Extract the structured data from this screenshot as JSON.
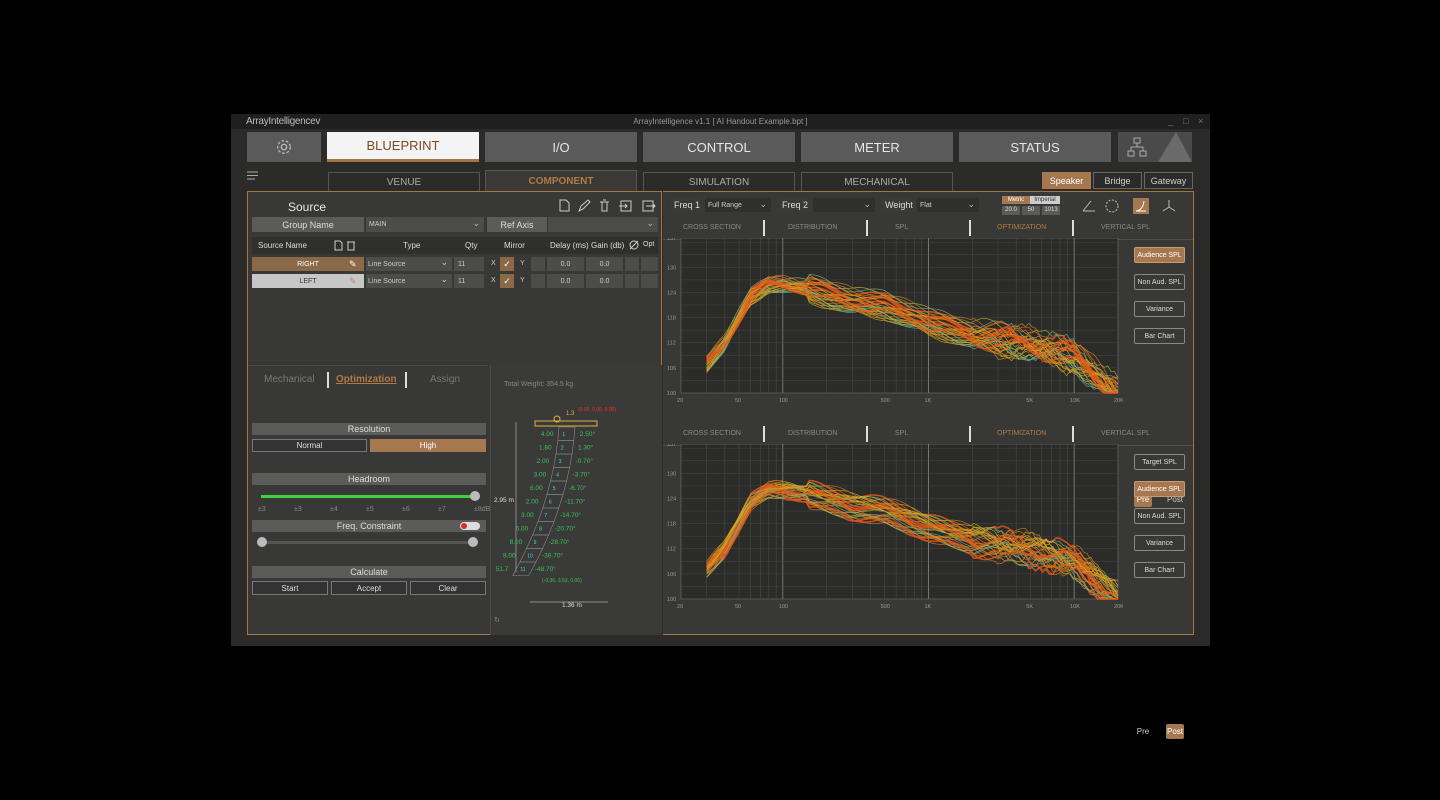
{
  "window": {
    "brand": "ArrayIntelligencev",
    "title": "ArrayIntelligence v1.1 [ AI Handout Example.bpt ]",
    "controls": [
      "_",
      "□",
      "×"
    ]
  },
  "nav": {
    "settings_icon": "gear-icon",
    "tabs": [
      "BLUEPRINT",
      "I/O",
      "CONTROL",
      "METER",
      "STATUS"
    ],
    "active_tab": "BLUEPRINT",
    "network_icon": "network-icon"
  },
  "subtabs": {
    "items": [
      "VENUE",
      "COMPONENT",
      "SIMULATION",
      "MECHANICAL"
    ],
    "active": "COMPONENT"
  },
  "mode_buttons": {
    "items": [
      "Speaker",
      "Bridge",
      "Gateway"
    ],
    "active": "Speaker"
  },
  "source": {
    "title": "Source",
    "group_name_label": "Group Name",
    "group_name_value": "MAIN",
    "ref_axis_label": "Ref Axis",
    "ref_axis_value": "",
    "columns": [
      "Source Name",
      "Type",
      "Qty",
      "Mirror",
      "Delay (ms)",
      "Gain (db)",
      "Opt"
    ],
    "rows": [
      {
        "name": "RIGHT",
        "type": "Line Source",
        "qty": "11",
        "x": "X",
        "y": "Y",
        "delay": "0.0",
        "gain": "0.0"
      },
      {
        "name": "LEFT",
        "type": "Line Source",
        "qty": "11",
        "x": "X",
        "y": "Y",
        "delay": "0.0",
        "gain": "0.0"
      }
    ]
  },
  "lower_tabs": {
    "items": [
      "Mechanical",
      "Optimization",
      "Assign"
    ],
    "active": "Optimization"
  },
  "optimization": {
    "resolution_label": "Resolution",
    "resolution_options": [
      "Normal",
      "High"
    ],
    "resolution_active": "High",
    "headroom_label": "Headroom",
    "headroom_ticks": [
      "±3",
      "±3",
      "±4",
      "±5",
      "±6",
      "±7",
      "±8dB"
    ],
    "headroom_value_pct": 100,
    "freq_constraint_label": "Freq. Constraint",
    "freq_constraint_on": true,
    "calculate_label": "Calculate",
    "calc_buttons": [
      "Start",
      "Accept",
      "Clear"
    ]
  },
  "array": {
    "total_weight": "Total Weight: 354.5 kg",
    "height_label": "2.95 m",
    "width_label": "1.36 m",
    "top_coords": "(0.00, 0.00, 0.00)",
    "bottom_coords": "(-0.36, 3.53, 0.06)",
    "top_gap": "1.3",
    "boxes": [
      {
        "n": "1",
        "left": "4.00",
        "right": "2.50°"
      },
      {
        "n": "2",
        "left": "1.80",
        "right": "1.30°"
      },
      {
        "n": "3",
        "left": "2.00",
        "right": "-0.70°"
      },
      {
        "n": "4",
        "left": "3.00",
        "right": "-3.70°"
      },
      {
        "n": "5",
        "left": "6.00",
        "right": "-6.70°"
      },
      {
        "n": "6",
        "left": "2.00",
        "right": "-11.70°"
      },
      {
        "n": "7",
        "left": "3.00",
        "right": "-14.70°"
      },
      {
        "n": "8",
        "left": "6.00",
        "right": "-20.70°"
      },
      {
        "n": "9",
        "left": "8.00",
        "right": "-28.70°"
      },
      {
        "n": "10",
        "left": "8.00",
        "right": "-36.70°"
      },
      {
        "n": "11",
        "left": "51.7",
        "right": "-48.70°"
      }
    ]
  },
  "analysis": {
    "freq1_label": "Freq 1",
    "freq1_value": "Full Range",
    "freq2_label": "Freq 2",
    "freq2_value": "",
    "weight_label": "Weight",
    "weight_value": "Flat",
    "unit_metric": "Metric",
    "unit_imperial": "Imperial",
    "env_values": [
      "20.0",
      "50",
      "1013"
    ],
    "plot_tabs": [
      "CROSS SECTION",
      "DISTRIBUTION",
      "SPL",
      "OPTIMIZATION",
      "VERTICAL SPL"
    ],
    "active_plot_tab": "OPTIMIZATION",
    "top_buttons": [
      "Audience SPL",
      "Non Aud. SPL",
      "Variance",
      "Bar Chart"
    ],
    "top_active": "Audience SPL",
    "top_pre_post": [
      "Pre",
      "Post"
    ],
    "top_prepost_active": "Pre",
    "bottom_buttons": [
      "Target SPL",
      "Audience SPL",
      "Non Aud. SPL",
      "Variance",
      "Bar Chart"
    ],
    "bottom_active": "Audience SPL",
    "bottom_pre_post": [
      "Pre",
      "Post"
    ],
    "bottom_prepost_active": "Post"
  },
  "chart_data": [
    {
      "type": "line",
      "x_ticks": [
        "20",
        "50",
        "100",
        "500",
        "1K",
        "5K",
        "10K",
        "20K"
      ],
      "y_ticks": [
        "137",
        "130",
        "124",
        "118",
        "112",
        "106",
        "100"
      ],
      "x_scale": "log",
      "xlim": [
        20,
        20000
      ],
      "ylim": [
        100,
        137
      ],
      "grid": true,
      "series_colors": [
        "#d9a521",
        "#c58a1f",
        "#e07a1c",
        "#e0571a",
        "#6cb08a",
        "#c9b233"
      ],
      "envelope": {
        "x": [
          20,
          40,
          60,
          80,
          100,
          150,
          300,
          500,
          1000,
          2000,
          5000,
          10000,
          20000
        ],
        "y": [
          100,
          112,
          123,
          126,
          126,
          125,
          122,
          121,
          117,
          114,
          112,
          109,
          100
        ]
      }
    },
    {
      "type": "line",
      "x_ticks": [
        "20",
        "50",
        "100",
        "500",
        "1K",
        "5K",
        "10K",
        "20K"
      ],
      "y_ticks": [
        "137",
        "130",
        "124",
        "118",
        "112",
        "106",
        "100"
      ],
      "x_scale": "log",
      "xlim": [
        20,
        20000
      ],
      "ylim": [
        100,
        137
      ],
      "grid": true,
      "series_colors": [
        "#d9a521",
        "#c58a1f",
        "#e07a1c",
        "#e0571a",
        "#6cb08a",
        "#c9b233"
      ],
      "envelope": {
        "x": [
          20,
          40,
          60,
          80,
          100,
          150,
          300,
          500,
          1000,
          2000,
          5000,
          10000,
          20000
        ],
        "y": [
          100,
          112,
          123,
          126,
          126,
          125,
          122,
          121,
          117,
          114,
          112,
          109,
          100
        ]
      }
    }
  ]
}
